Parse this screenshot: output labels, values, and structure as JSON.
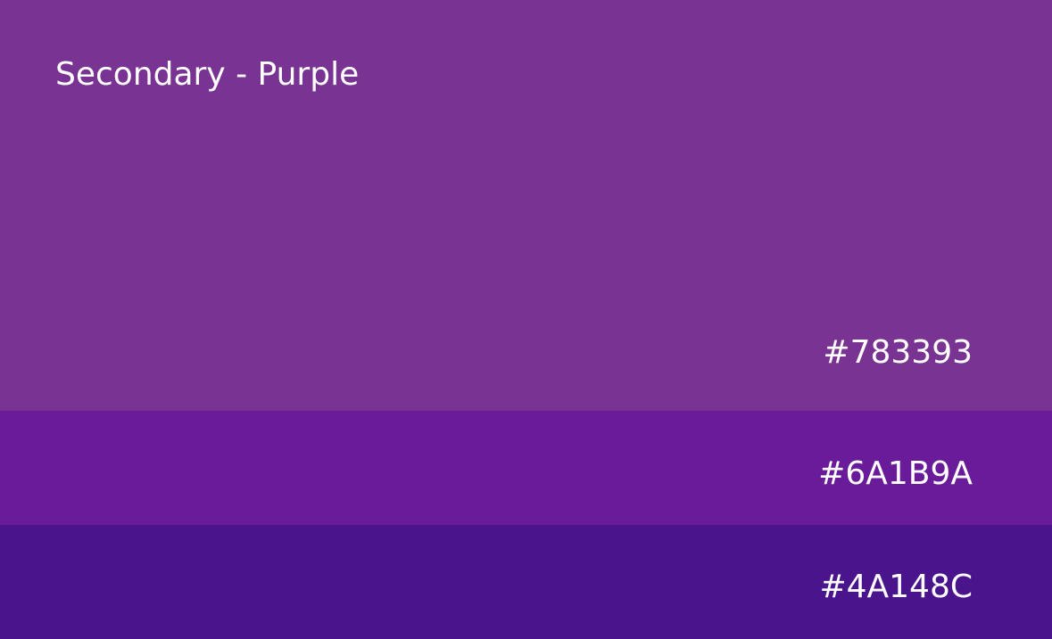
{
  "palette": {
    "title": "Secondary - Purple",
    "swatches": [
      {
        "hex": "#783393",
        "color": "#783393"
      },
      {
        "hex": "#6A1B9A",
        "color": "#6A1B9A"
      },
      {
        "hex": "#4A148C",
        "color": "#4A148C"
      }
    ],
    "text_color": "#FFFFFF"
  }
}
